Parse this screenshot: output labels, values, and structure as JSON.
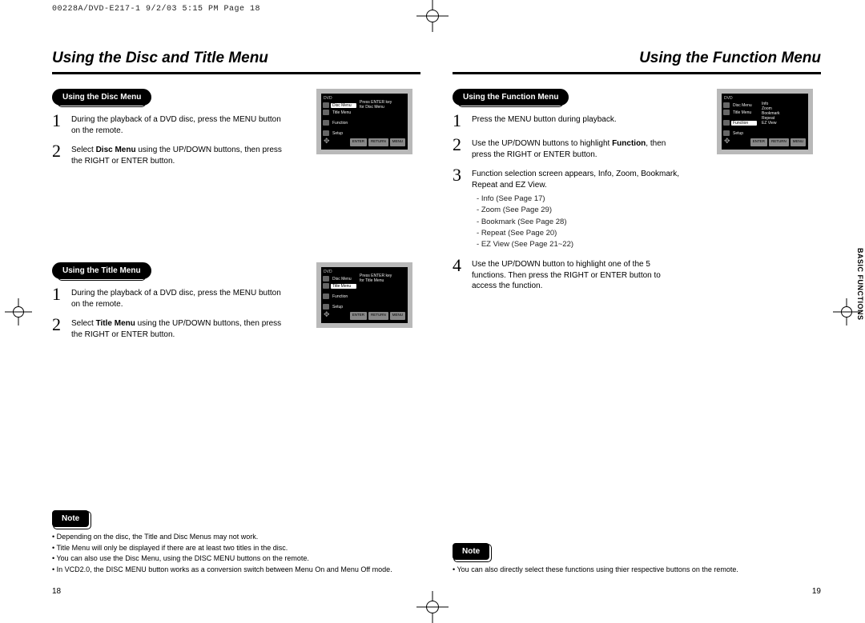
{
  "printHeader": "00228A/DVD-E217-1  9/2/03 5:15 PM  Page 18",
  "left": {
    "title": "Using the Disc and Title Menu",
    "section1": {
      "pill": "Using the Disc Menu",
      "step1": "During the playback of a DVD disc, press the MENU button on the remote.",
      "step2_a": "Select ",
      "step2_b": "Disc Menu",
      "step2_c": " using the UP/DOWN buttons, then press the RIGHT or ENTER button."
    },
    "section2": {
      "pill": "Using the Title Menu",
      "step1": "During the playback of a DVD disc, press the MENU button on the remote.",
      "step2_a": "Select ",
      "step2_b": "Title Menu",
      "step2_c": " using the UP/DOWN buttons, then press the RIGHT or ENTER button."
    },
    "noteLabel": "Note",
    "notes": [
      "Depending on the disc, the Title and Disc Menus may not work.",
      "Title Menu will only be displayed if there are at least two titles in the disc.",
      "You can also use the Disc Menu, using the DISC MENU buttons on the remote.",
      "In VCD2.0, the DISC MENU button works as a conversion switch between Menu On and Menu Off mode."
    ],
    "pageNum": "18"
  },
  "right": {
    "title": "Using the Function Menu",
    "pill": "Using the Function Menu",
    "step1": "Press the MENU button during playback.",
    "step2_a": "Use the UP/DOWN buttons to highlight ",
    "step2_b": "Function",
    "step2_c": ", then press the RIGHT or ENTER button.",
    "step3": "Function selection screen appears, Info, Zoom, Bookmark, Repeat and EZ View.",
    "sub": [
      "Info (See Page 17)",
      "Zoom (See Page 29)",
      "Bookmark (See Page 28)",
      "Repeat (See Page 20)",
      "EZ View (See Page 21~22)"
    ],
    "step4": "Use the UP/DOWN button to highlight one of the 5 functions. Then press the RIGHT or ENTER button to access the function.",
    "noteLabel": "Note",
    "notes": [
      "You can also directly select these functions using thier respective buttons on the remote."
    ],
    "pageNum": "19",
    "sideTab": "BASIC FUNCTIONS"
  },
  "tv": {
    "dvd": "DVD",
    "discMenu": "Disc Menu",
    "titleMenu": "Title Menu",
    "function": "Function",
    "setup": "Setup",
    "msgDisc1": "Press ENTER key",
    "msgDisc2": "for Disc Menu",
    "msgTitle1": "Press ENTER key",
    "msgTitle2": "for Title Menu",
    "opts": [
      "Info",
      "Zoom",
      "Bookmark",
      "Repeat",
      "EZ View"
    ],
    "enter": "ENTER",
    "return": "RETURN",
    "menu": "MENU"
  }
}
